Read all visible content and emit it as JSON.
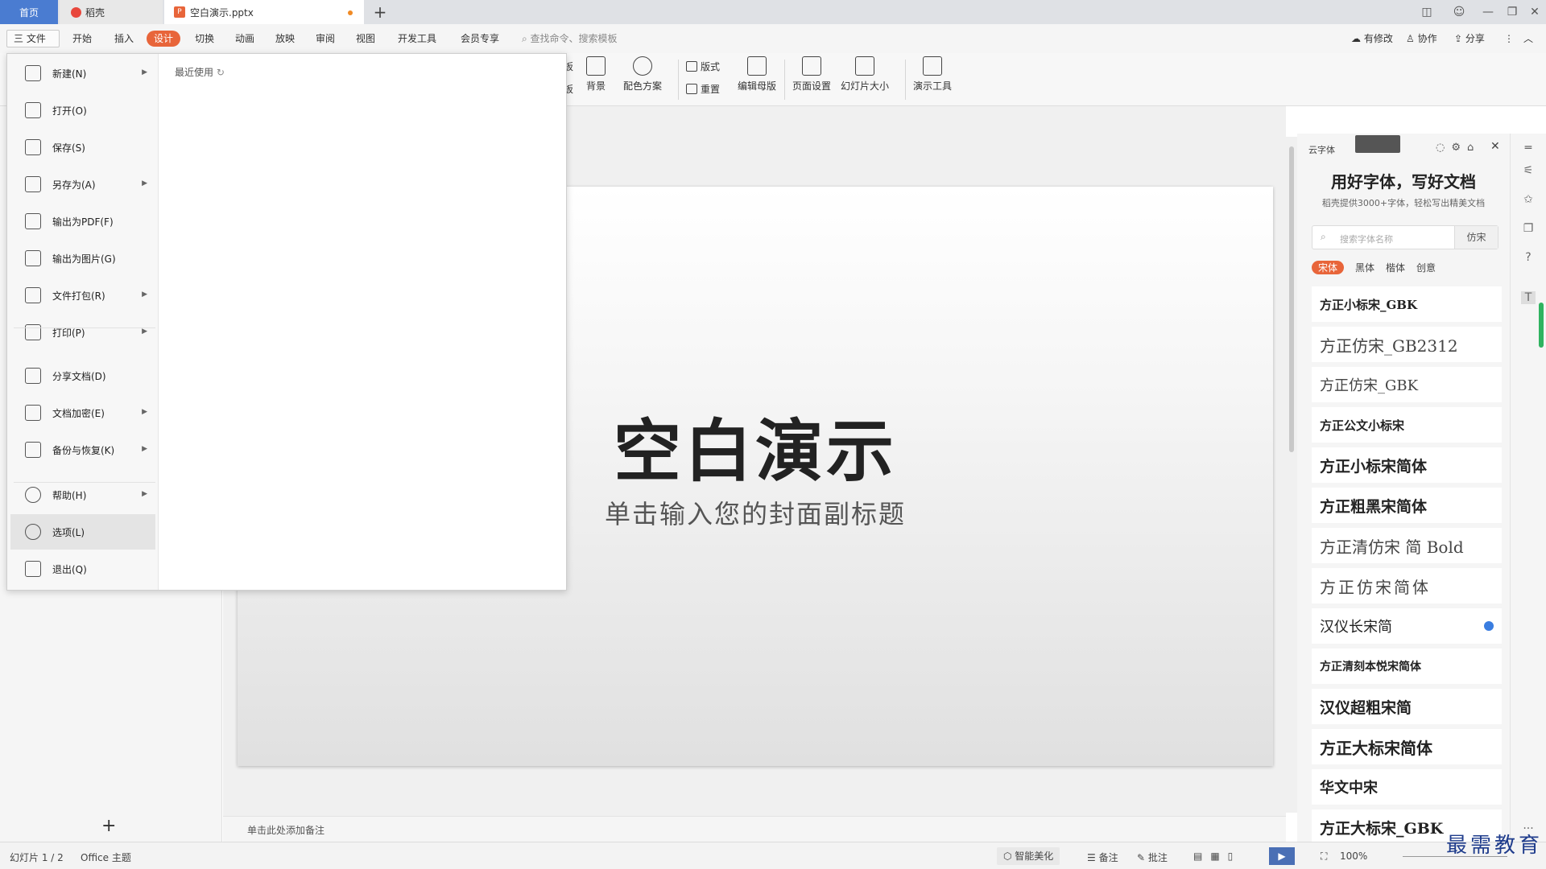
{
  "tabs": {
    "home": "首页",
    "daoke": "稻壳",
    "doc": "空白演示.pptx",
    "add": "+"
  },
  "menu": {
    "file": "三 文件",
    "items": [
      "开始",
      "插入",
      "设计",
      "切换",
      "动画",
      "放映",
      "审阅",
      "视图",
      "开发工具",
      "会员专享"
    ],
    "search": "查找命令、搜索模板",
    "right": [
      "有修改",
      "协作",
      "分享"
    ]
  },
  "ribbon": {
    "partial_top": "板",
    "partial_bottom": "板",
    "background": "背景",
    "color_scheme": "配色方案",
    "layout": "版式",
    "reset": "重置",
    "edit_master": "编辑母版",
    "page_setup": "页面设置",
    "slide_size": "幻灯片大小",
    "present_tools": "演示工具"
  },
  "filemenu": {
    "recent": "最近使用",
    "items": [
      "新建(N)",
      "打开(O)",
      "保存(S)",
      "另存为(A)",
      "输出为PDF(F)",
      "输出为图片(G)",
      "文件打包(R)",
      "打印(P)",
      "分享文档(D)",
      "文档加密(E)",
      "备份与恢复(K)",
      "帮助(H)",
      "选项(L)",
      "退出(Q)"
    ]
  },
  "slide": {
    "title": "空白演示",
    "subtitle": "单击输入您的封面副标题"
  },
  "notes": "单击此处添加备注",
  "fontpanel": {
    "header": "云字体",
    "title": "用好字体，写好文档",
    "subtitle": "稻壳提供3000+字体，轻松写出精美文档",
    "search_placeholder": "搜索字体名称",
    "search_btn": "仿宋",
    "cats": [
      "宋体",
      "黑体",
      "楷体",
      "创意"
    ],
    "fonts": [
      "方正小标宋_GBK",
      "方正仿宋_GB2312",
      "方正仿宋_GBK",
      "方正公文小标宋",
      "方正小标宋简体",
      "方正粗黑宋简体",
      "方正清仿宋 简 Bold",
      "方正仿宋简体",
      "汉仪长宋简",
      "方正清刻本悦宋简体",
      "汉仪超粗宋简",
      "方正大标宋简体",
      "华文中宋",
      "方正大标宋_GBK"
    ]
  },
  "status": {
    "slide": "幻灯片 1 / 2",
    "theme": "Office 主题",
    "beautify": "智能美化",
    "notes": "备注",
    "comment": "批注",
    "zoom": "100%"
  },
  "watermark": "最需教育"
}
